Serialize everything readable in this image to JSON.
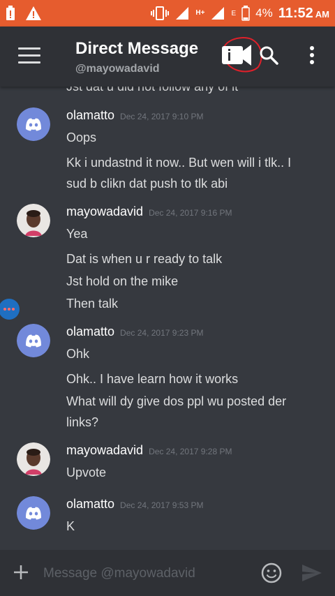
{
  "status_bar": {
    "battery_percent": "4%",
    "time": "11:52",
    "ampm": "AM",
    "network_h": "H+",
    "network_e": "E"
  },
  "header": {
    "title": "Direct Message",
    "subtitle": "@mayowadavid"
  },
  "cut_off_message": "Jst dat u did not follow any of it",
  "messages": [
    {
      "author": "olamatto",
      "timestamp": "Dec 24, 2017 9:10 PM",
      "lines": [
        "Oops",
        "Kk i undastnd it now.. But wen will i tlk.. I",
        "sud b clikn dat push to tlk abi"
      ]
    },
    {
      "author": "mayowadavid",
      "timestamp": "Dec 24, 2017 9:16 PM",
      "lines": [
        "Yea",
        "Dat is when u r ready to talk",
        "Jst hold on the mike",
        "Then talk"
      ]
    },
    {
      "author": "olamatto",
      "timestamp": "Dec 24, 2017 9:23 PM",
      "lines": [
        "Ohk",
        "Ohk.. I have learn how it works",
        "What will dy give dos ppl wu posted der",
        "links?"
      ]
    },
    {
      "author": "mayowadavid",
      "timestamp": "Dec 24, 2017 9:28 PM",
      "lines": [
        "Upvote"
      ]
    },
    {
      "author": "olamatto",
      "timestamp": "Dec 24, 2017 9:53 PM",
      "lines": [
        "K"
      ]
    }
  ],
  "composer": {
    "placeholder": "Message @mayowadavid"
  },
  "colors": {
    "status_bar": "#e65c2e",
    "background": "#36393f",
    "header": "#2f3136",
    "discord_blurple": "#7289da",
    "annotation_red": "#e0202a"
  },
  "icons": [
    "warning-icon",
    "vibrate-icon",
    "signal-icon",
    "battery-icon",
    "menu-icon",
    "video-call-icon",
    "search-icon",
    "more-icon",
    "discord-avatar-icon",
    "add-icon",
    "emoji-icon",
    "send-icon"
  ]
}
